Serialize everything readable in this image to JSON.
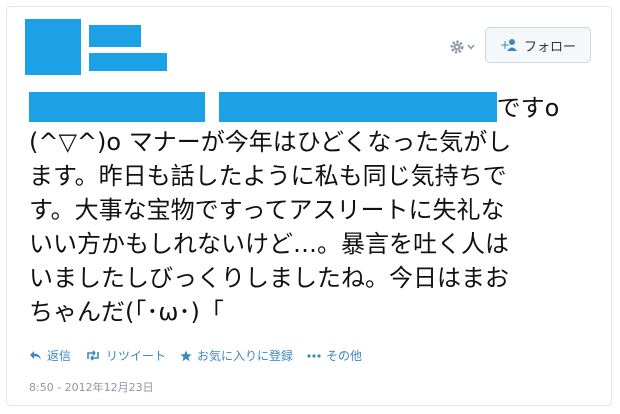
{
  "header": {
    "follow_label": "フォロー"
  },
  "tweet": {
    "line1_tail": "です",
    "line1_mark": "o",
    "lines": [
      "(^▽^)o マナーが今年はひどくなった気がし",
      "ます。昨日も話したように私も同じ気持ちで",
      "す。大事な宝物ですってアスリートに失礼な",
      "いい方かもしれないけど…。暴言を吐く人は",
      "いましたしびっくりしましたね。今日はまお",
      "ちゃんだ(「･ω･)「"
    ]
  },
  "actions": [
    {
      "label": "返信",
      "icon": "reply-icon"
    },
    {
      "label": "リツイート",
      "icon": "retweet-icon"
    },
    {
      "label": "お気に入りに登録",
      "icon": "star-icon"
    },
    {
      "label": "その他",
      "icon": "more-icon"
    }
  ],
  "timestamp": "8:50 - 2012年12月23日",
  "colors": {
    "redaction": "#1da1e6",
    "link": "#3b88c3",
    "muted": "#8899a6"
  }
}
